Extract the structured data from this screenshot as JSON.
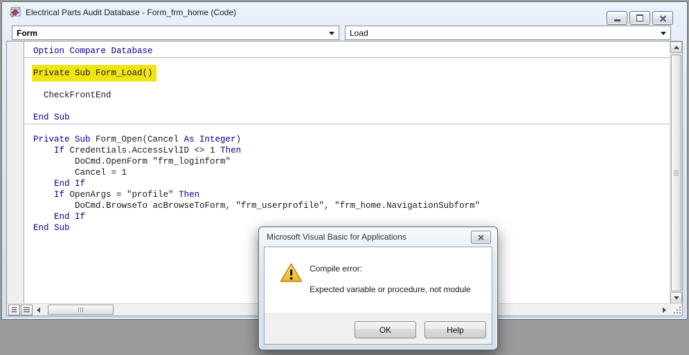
{
  "window": {
    "title": "Electrical Parts Audit Database - Form_frm_home (Code)"
  },
  "toolbar": {
    "object_combo_value": "Form",
    "procedure_combo_value": "Load"
  },
  "code": {
    "lines": [
      {
        "tokens": [
          [
            "Option Compare Database",
            "k"
          ]
        ]
      },
      {
        "tokens": []
      },
      {
        "highlight": true,
        "tokens": [
          [
            "Private Sub Form_Load()",
            "h"
          ]
        ]
      },
      {
        "tokens": []
      },
      {
        "tokens": [
          [
            "  CheckFrontEnd",
            "n"
          ]
        ]
      },
      {
        "tokens": []
      },
      {
        "tokens": [
          [
            "End Sub",
            "k"
          ]
        ]
      },
      {
        "tokens": []
      },
      {
        "tokens": [
          [
            "Private Sub ",
            "k"
          ],
          [
            "Form_Open(Cancel ",
            "n"
          ],
          [
            "As Integer",
            "k"
          ],
          [
            ")",
            "n"
          ]
        ]
      },
      {
        "tokens": [
          [
            "    ",
            "n"
          ],
          [
            "If ",
            "k"
          ],
          [
            "Credentials.AccessLvlID <> 1 ",
            "n"
          ],
          [
            "Then",
            "k"
          ]
        ]
      },
      {
        "tokens": [
          [
            "        DoCmd.OpenForm \"frm_loginform\"",
            "n"
          ]
        ]
      },
      {
        "tokens": [
          [
            "        Cancel = 1",
            "n"
          ]
        ]
      },
      {
        "tokens": [
          [
            "    ",
            "n"
          ],
          [
            "End If",
            "k"
          ]
        ]
      },
      {
        "tokens": [
          [
            "    ",
            "n"
          ],
          [
            "If ",
            "k"
          ],
          [
            "OpenArgs = \"profile\" ",
            "n"
          ],
          [
            "Then",
            "k"
          ]
        ]
      },
      {
        "tokens": [
          [
            "        DoCmd.BrowseTo acBrowseToForm, \"frm_userprofile\", \"frm_home.NavigationSubform\"",
            "n"
          ]
        ]
      },
      {
        "tokens": [
          [
            "    ",
            "n"
          ],
          [
            "End If",
            "k"
          ]
        ]
      },
      {
        "tokens": [
          [
            "End Sub",
            "k"
          ]
        ]
      }
    ]
  },
  "dialog": {
    "title": "Microsoft Visual Basic for Applications",
    "message_line1": "Compile error:",
    "message_line2": "Expected variable or procedure, not module",
    "ok_label": "OK",
    "help_label": "Help"
  },
  "colors": {
    "keyword_blue": "#000096",
    "code_text": "#1a1a1a",
    "highlight_background": "#f0e414",
    "highlight_text": "#8e8e55",
    "desktop_background": "#9b9b9b",
    "warning_yellow": "#fcc928"
  }
}
